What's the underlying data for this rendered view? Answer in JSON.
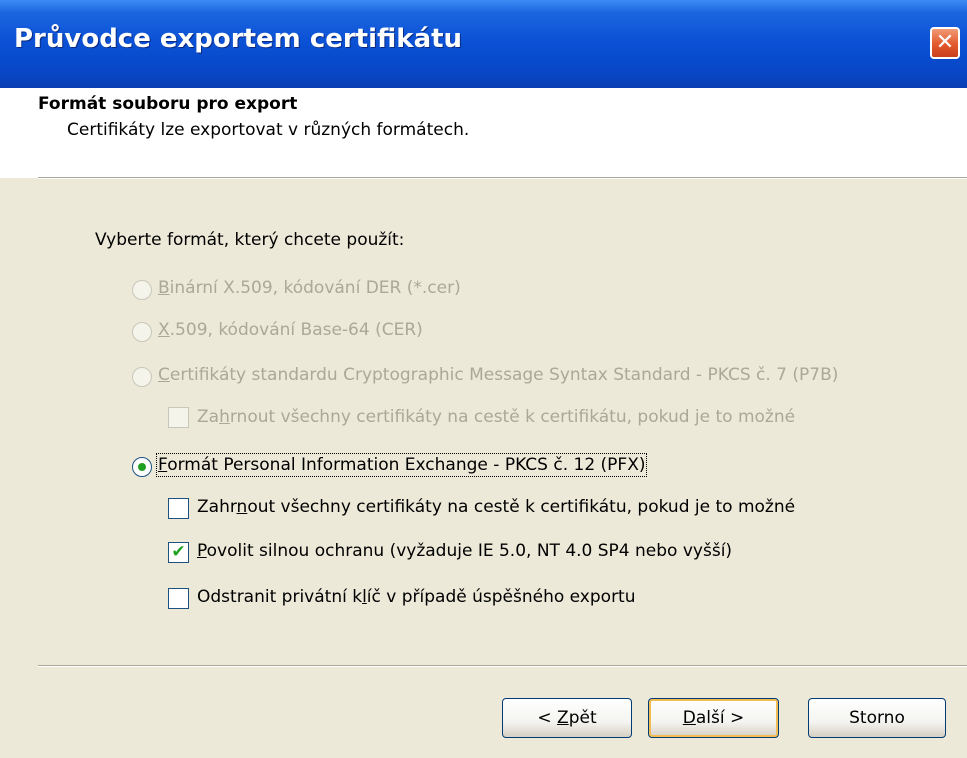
{
  "window": {
    "title": "Průvodce exportem certifikátu",
    "close_glyph": "✕"
  },
  "header": {
    "title": "Formát souboru pro export",
    "subtitle": "Certifikáty lze exportovat v různých formátech."
  },
  "prompt": "Vyberte formát, který chcete použít:",
  "options": {
    "der": {
      "pre": "",
      "key": "B",
      "post": "inární X.509, kódování DER (*.cer)",
      "enabled": false,
      "selected": false
    },
    "base64": {
      "pre": "",
      "key": "X",
      "post": ".509, kódování Base-64 (CER)",
      "enabled": false,
      "selected": false
    },
    "pkcs7": {
      "pre": "",
      "key": "C",
      "post": "ertifikáty standardu Cryptographic Message Syntax Standard - PKCS č. 7 (P7B)",
      "enabled": false,
      "selected": false
    },
    "pkcs7_include": {
      "pre": "Za",
      "key": "h",
      "post": "rnout všechny certifikáty na cestě k certifikátu, pokud je to možné",
      "enabled": false,
      "checked": false
    },
    "pfx": {
      "pre": "",
      "key": "F",
      "post": "ormát Personal Information Exchange - PKCS č. 12 (PFX)",
      "enabled": true,
      "selected": true
    },
    "pfx_include": {
      "pre": "Zahr",
      "key": "n",
      "post": "out všechny certifikáty na cestě k certifikátu, pokud je to možné",
      "enabled": true,
      "checked": false
    },
    "strong": {
      "pre": "",
      "key": "P",
      "post": "ovolit silnou ochranu (vyžaduje IE 5.0, NT 4.0 SP4 nebo vyšší)",
      "enabled": true,
      "checked": true
    },
    "delete_key": {
      "pre": "Odstranit privátní k",
      "key": "l",
      "post": "íč v případě úspěšného exportu",
      "enabled": true,
      "checked": false
    }
  },
  "check_glyph": "✔",
  "buttons": {
    "back": {
      "pre": "< ",
      "key": "Z",
      "post": "pět"
    },
    "next": {
      "pre": "",
      "key": "D",
      "post": "alší >"
    },
    "cancel": {
      "pre": "Storno",
      "key": "",
      "post": ""
    }
  },
  "colors": {
    "titlebar": "#0b52d6",
    "dialog": "#ece9d8",
    "disabled_text": "#aca899",
    "check": "#21a121",
    "radio_dot": "#20a020",
    "close": "#e2592d"
  }
}
